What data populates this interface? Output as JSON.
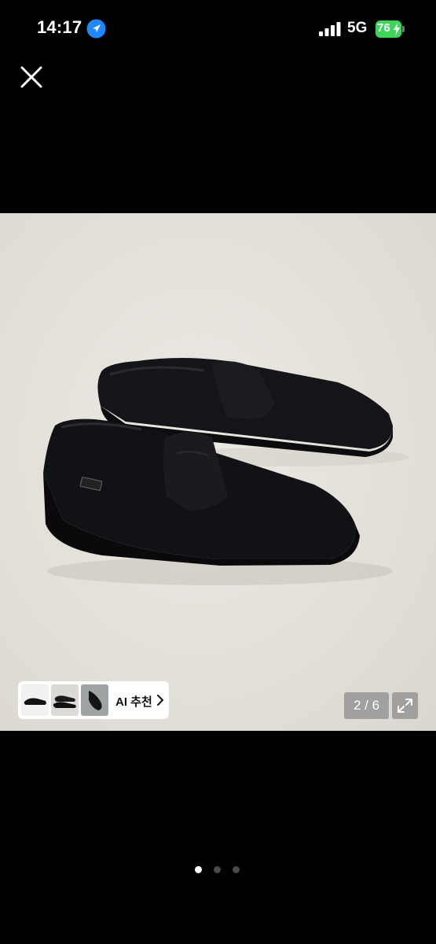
{
  "status_bar": {
    "time": "14:17",
    "network": "5G",
    "battery": "76"
  },
  "gallery": {
    "counter": "2 / 6",
    "ai_label": "AI 추천",
    "active_page": 0,
    "page_count": 3
  },
  "colors": {
    "background": "#000000",
    "photo_background": "#e7e4df",
    "battery": "#3ed45b",
    "location_accent": "#1e88ff"
  },
  "icons": {
    "close": "close-icon",
    "location": "location-arrow-icon",
    "signal": "signal-bars-icon",
    "expand": "expand-icon",
    "chevron": "chevron-right-icon"
  }
}
